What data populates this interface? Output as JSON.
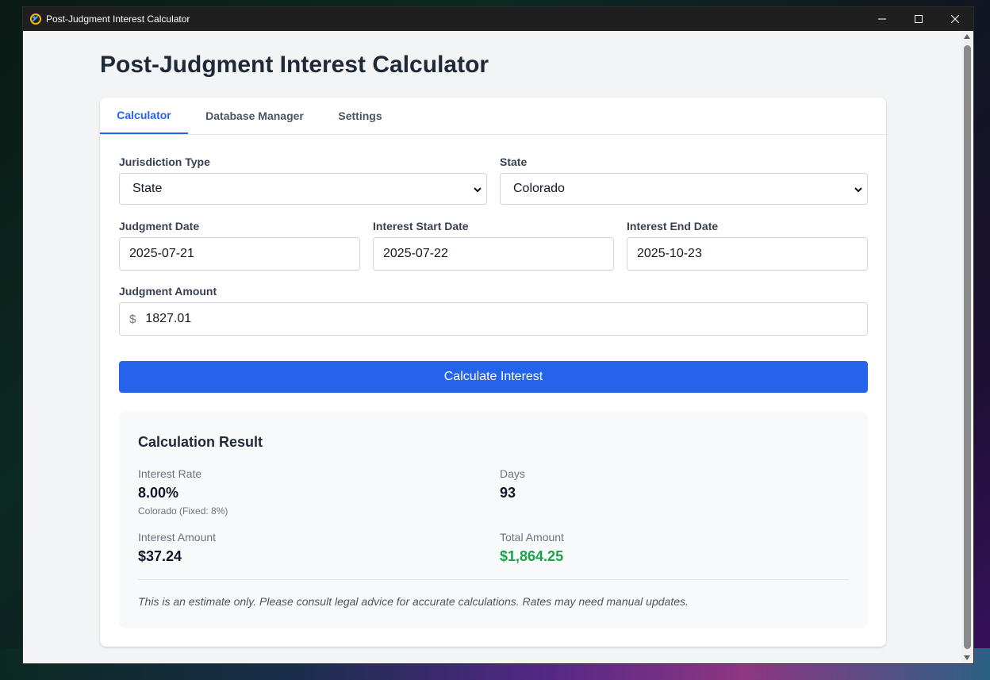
{
  "window": {
    "title": "Post-Judgment Interest Calculator",
    "controls": {
      "minimize": "—",
      "maximize": "☐",
      "close": "✕"
    },
    "icon": "app-link-icon"
  },
  "page": {
    "title": "Post-Judgment Interest Calculator"
  },
  "tabs": [
    {
      "label": "Calculator",
      "active": true
    },
    {
      "label": "Database Manager",
      "active": false
    },
    {
      "label": "Settings",
      "active": false
    }
  ],
  "form": {
    "jurisdiction_type": {
      "label": "Jurisdiction Type",
      "value": "State"
    },
    "state": {
      "label": "State",
      "value": "Colorado"
    },
    "judgment_date": {
      "label": "Judgment Date",
      "value": "2025-07-21"
    },
    "interest_start_date": {
      "label": "Interest Start Date",
      "value": "2025-07-22"
    },
    "interest_end_date": {
      "label": "Interest End Date",
      "value": "2025-10-23"
    },
    "judgment_amount": {
      "label": "Judgment Amount",
      "currency_symbol": "$",
      "value": "1827.01"
    },
    "calculate_button": "Calculate Interest"
  },
  "result": {
    "title": "Calculation Result",
    "interest_rate": {
      "label": "Interest Rate",
      "value": "8.00%",
      "note": "Colorado (Fixed: 8%)"
    },
    "days": {
      "label": "Days",
      "value": "93"
    },
    "interest_amount": {
      "label": "Interest Amount",
      "value": "$37.24"
    },
    "total_amount": {
      "label": "Total Amount",
      "value": "$1,864.25"
    },
    "disclaimer": "This is an estimate only. Please consult legal advice for accurate calculations. Rates may need manual updates."
  },
  "colors": {
    "accent": "#2563eb",
    "total_green": "#16a34a",
    "titlebar": "#1f1f1f"
  }
}
